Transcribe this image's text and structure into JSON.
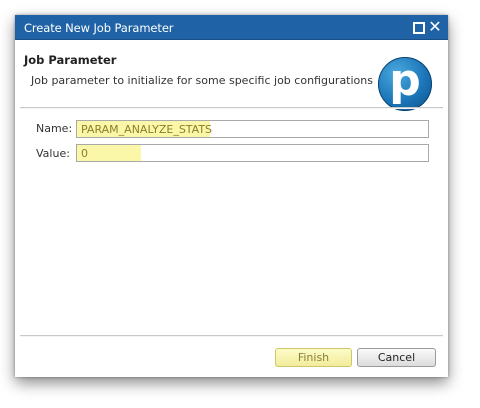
{
  "window": {
    "title": "Create New Job Parameter",
    "restore_icon": "restore-icon",
    "close_icon": "close-icon",
    "close_glyph": "✕"
  },
  "header": {
    "title": "Job Parameter",
    "description": "Job parameter to initialize for some specific job configurations",
    "logo_letter": "p"
  },
  "form": {
    "name_label": "Name:",
    "name_value": "PARAM_ANALYZE_STATS",
    "value_label": "Value:",
    "value_value": "0"
  },
  "buttons": {
    "finish_label": "Finish",
    "cancel_label": "Cancel"
  },
  "colors": {
    "titlebar": "#1f63a6",
    "highlight": "#fbf7a9",
    "logo": "#1b75b8"
  }
}
